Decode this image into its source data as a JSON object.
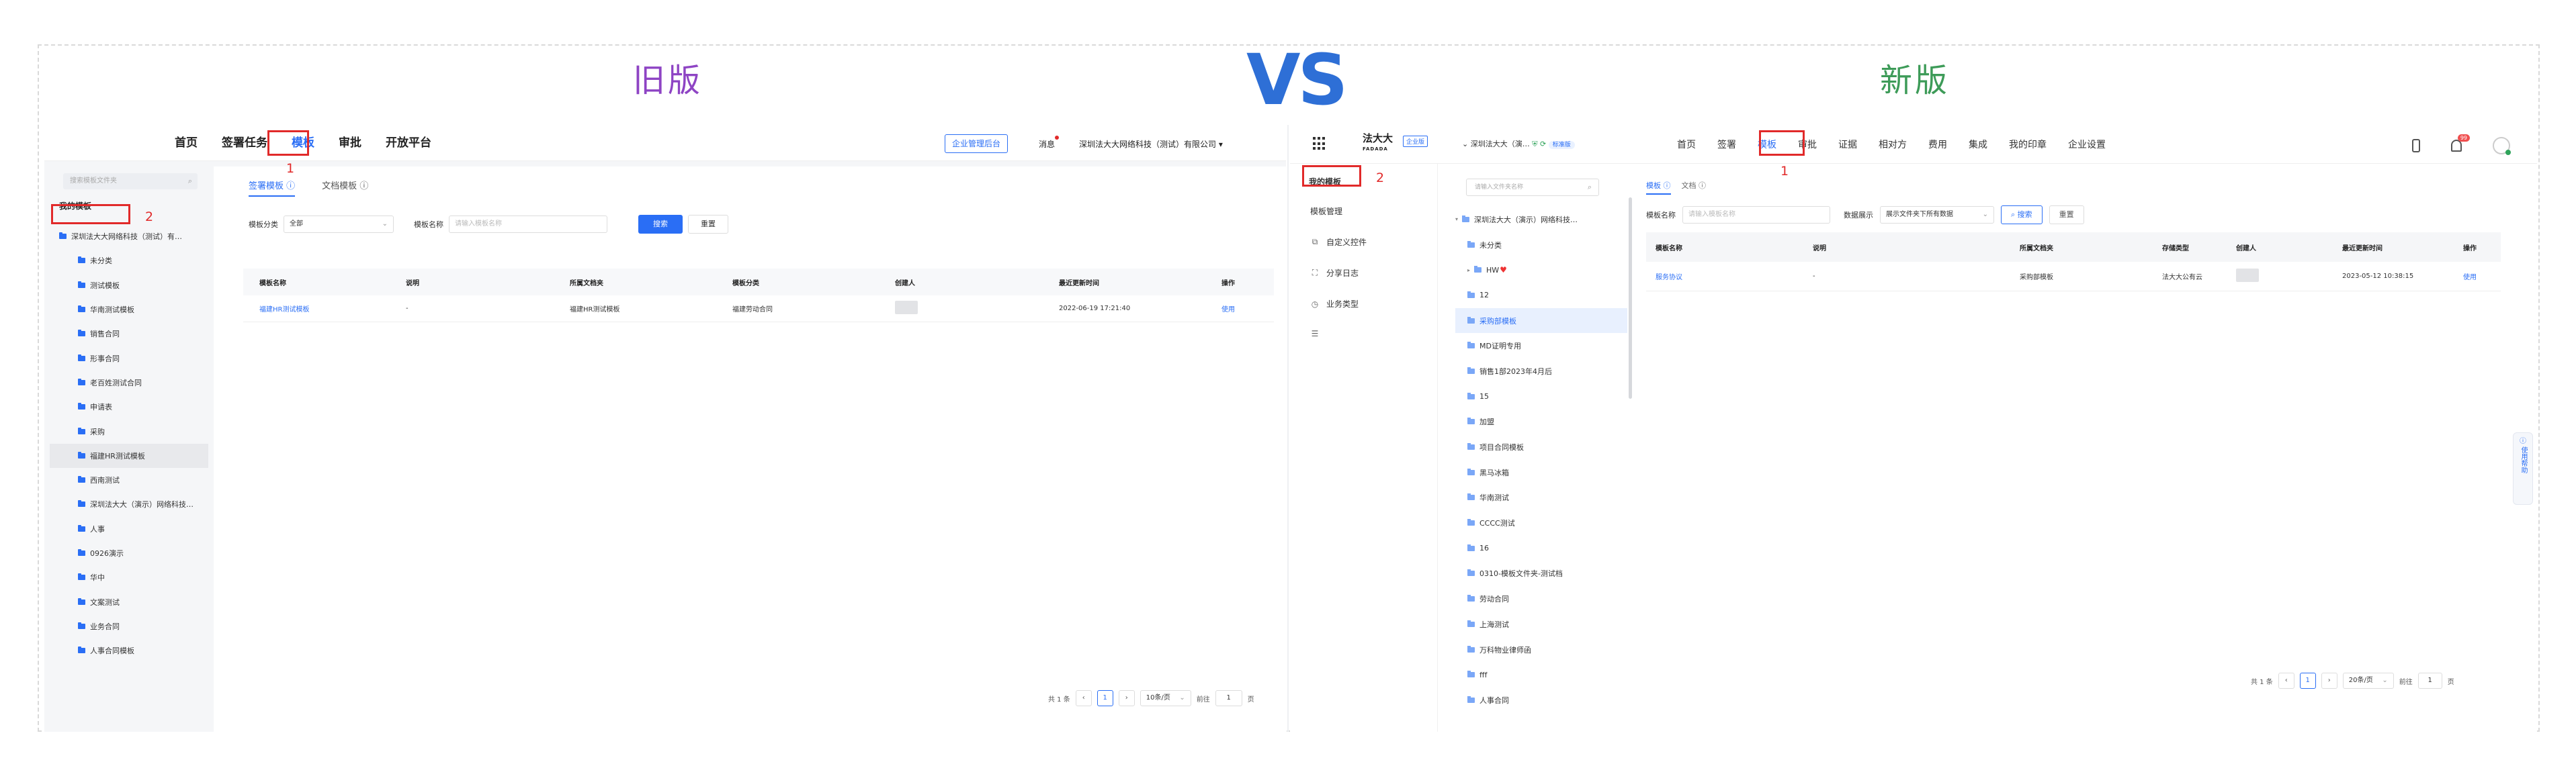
{
  "headings": {
    "old": "旧版",
    "vs": "VS",
    "new": "新版"
  },
  "old": {
    "nav": [
      "首页",
      "签署任务",
      "模板",
      "审批",
      "开放平台"
    ],
    "corp_button": "企业管理后台",
    "message": "消息",
    "company": "深圳法大大网络科技（测试）有限公司",
    "search_placeholder": "搜索模板文件夹",
    "my_templates": "我的模板",
    "tree": [
      "深圳法大大网络科技（测试）有…",
      "未分类",
      "测试模板",
      "华南测试模板",
      "销售合同",
      "形事合同",
      "老百姓测试合同",
      "申请表",
      "采购",
      "福建HR测试模板",
      "西南测试",
      "深圳法大大（演示）网络科技…",
      "人事",
      "0926演示",
      "华中",
      "文案测试",
      "业务合同",
      "人事合同模板"
    ],
    "tabs": [
      "签署模板",
      "文档模板"
    ],
    "filter": {
      "category_label": "模板分类",
      "category_value": "全部",
      "name_label": "模板名称",
      "name_placeholder": "请输入模板名称",
      "search_btn": "搜索",
      "reset_btn": "重置"
    },
    "columns": [
      "模板名称",
      "说明",
      "所属文档夹",
      "模板分类",
      "创建人",
      "最近更新时间",
      "操作"
    ],
    "rows": [
      {
        "name": "福建HR测试模板",
        "desc": "-",
        "folder": "福建HR测试模板",
        "category": "福建劳动合同",
        "updated": "2022-06-19 17:21:40",
        "action": "使用"
      }
    ],
    "pager": {
      "total": "共 1 条",
      "page": "1",
      "size": "10条/页",
      "goto": "前往",
      "goto_val": "1",
      "unit": "页"
    }
  },
  "new": {
    "logo": "法大大",
    "logo_sub": "FADADA",
    "ent_badge": "企业版",
    "org": "深圳法大大（演…",
    "org_tag": "标准版",
    "nav": [
      "首页",
      "签署",
      "模板",
      "审批",
      "证据",
      "相对方",
      "费用",
      "集成",
      "我的印章",
      "企业设置"
    ],
    "bell_count": "99",
    "left_menu": [
      "我的模板",
      "模板管理",
      "自定义控件",
      "分享日志",
      "业务类型"
    ],
    "search_placeholder": "请输入文件夹名称",
    "tree": [
      "深圳法大大（演示）网络科技…",
      "未分类",
      "HW",
      "12",
      "采购部模板",
      "MD证明专用",
      "销售1部2023年4月后",
      "15",
      "加盟",
      "项目合同模板",
      "黑马冰箱",
      "华南测试",
      "CCCC测试",
      "16",
      "0310-模板文件夹-测试档",
      "劳动合同",
      "上海测试",
      "万科物业律师函",
      "fff",
      "人事合同"
    ],
    "tabs": [
      "模板",
      "文档"
    ],
    "filter": {
      "name_label": "模板名称",
      "name_placeholder": "请输入模板名称",
      "scope_label": "数据展示",
      "scope_value": "展示文件夹下所有数据",
      "search_btn": "搜索",
      "reset_btn": "重置"
    },
    "columns": [
      "模板名称",
      "说明",
      "所属文档夹",
      "存储类型",
      "创建人",
      "最近更新时间",
      "操作"
    ],
    "rows": [
      {
        "name": "服务协议",
        "desc": "-",
        "folder": "采购部模板",
        "storage": "法大大公有云",
        "updated": "2023-05-12 10:38:15",
        "action": "使用"
      }
    ],
    "pager": {
      "total": "共 1 条",
      "page": "1",
      "size": "20条/页",
      "goto": "前往",
      "goto_val": "1",
      "unit": "页"
    },
    "help": "使用帮助"
  },
  "annotations": {
    "one": "1",
    "two": "2"
  },
  "colors": {
    "accent": "#2a6ef5",
    "highlight": "#e12a2a",
    "old_heading": "#8e44c4",
    "new_heading": "#3d9b58"
  }
}
